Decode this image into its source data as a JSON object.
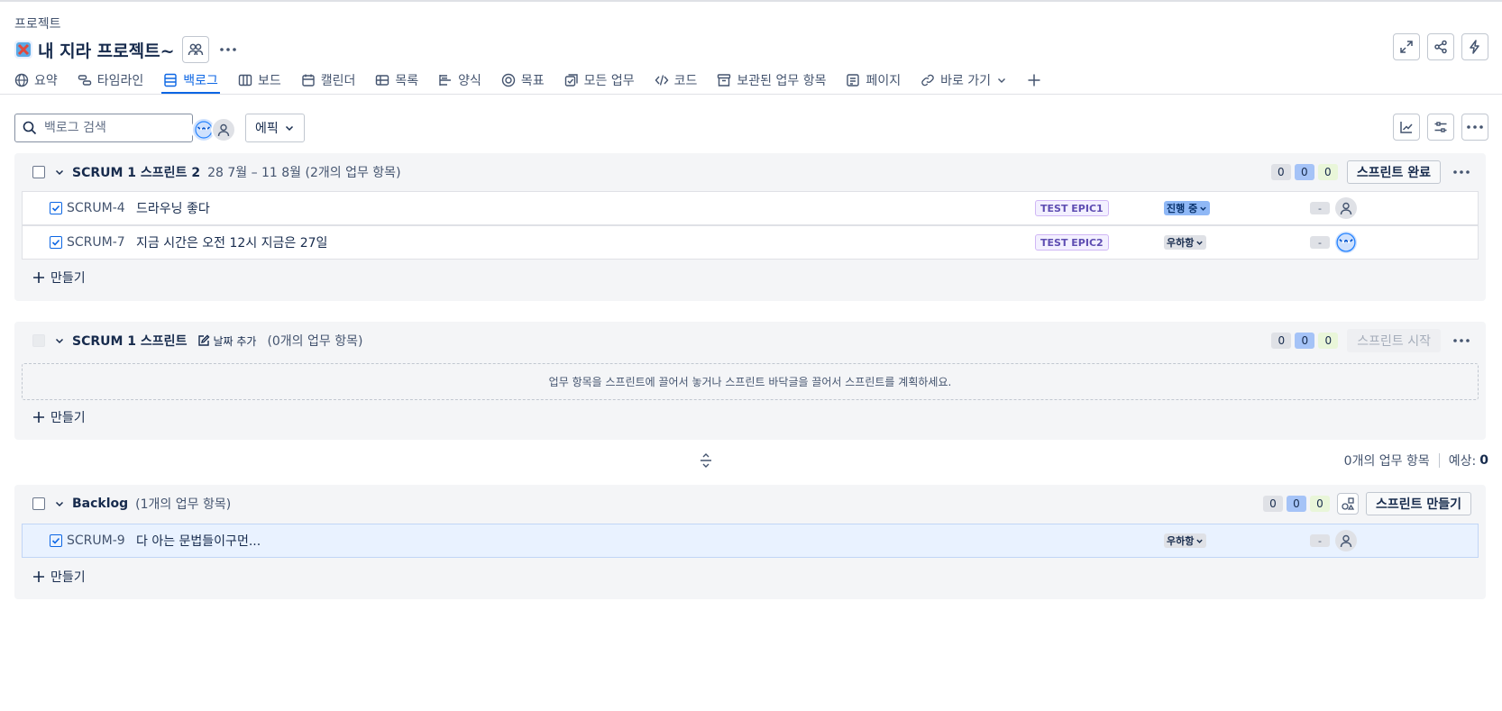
{
  "breadcrumb": "프로젝트",
  "project": {
    "title": "내 지라 프로젝트~"
  },
  "tabs": [
    {
      "label": "요약",
      "icon": "globe-icon"
    },
    {
      "label": "타임라인",
      "icon": "timeline-icon"
    },
    {
      "label": "백로그",
      "icon": "backlog-icon",
      "active": true
    },
    {
      "label": "보드",
      "icon": "board-icon"
    },
    {
      "label": "캘린더",
      "icon": "calendar-icon"
    },
    {
      "label": "목록",
      "icon": "list-icon"
    },
    {
      "label": "양식",
      "icon": "form-icon"
    },
    {
      "label": "목표",
      "icon": "goal-icon"
    },
    {
      "label": "모든 업무",
      "icon": "all-work-icon"
    },
    {
      "label": "코드",
      "icon": "code-icon"
    },
    {
      "label": "보관된 업무 항목",
      "icon": "archive-icon"
    },
    {
      "label": "페이지",
      "icon": "page-icon"
    },
    {
      "label": "바로 가기",
      "icon": "link-icon"
    }
  ],
  "search": {
    "placeholder": "백로그 검색"
  },
  "epic_filter": "에픽",
  "sprints": [
    {
      "name": "SCRUM 1 스프린트 2",
      "meta": "28 7월 – 11 8월 (2개의 업무 항목)",
      "counts": [
        "0",
        "0",
        "0"
      ],
      "action": "스프린트 완료",
      "issues": [
        {
          "key": "SCRUM-4",
          "summary": "드라우닝 좋다",
          "epic": "TEST EPIC1",
          "status": "진행 중",
          "estimate": "-"
        },
        {
          "key": "SCRUM-7",
          "summary": "지금 시간은 오전 12시 지금은 27일",
          "epic": "TEST EPIC2",
          "status": "우하항",
          "estimate": "-"
        }
      ],
      "create_label": "만들기"
    },
    {
      "name": "SCRUM 1 스프린트",
      "add_date": "날짜 추가",
      "meta": "(0개의 업무 항목)",
      "counts": [
        "0",
        "0",
        "0"
      ],
      "action": "스프린트 시작",
      "empty_message": "업무 항목을 스프린트에 끌어서 놓거나 스프린트 바닥글을 끌어서 스프린트를 계획하세요.",
      "create_label": "만들기"
    }
  ],
  "summary_line": {
    "count_text": "0개의 업무 항목",
    "estimate_label": "예상:",
    "estimate_value": "0"
  },
  "backlog": {
    "name": "Backlog",
    "meta": "(1개의 업무 항목)",
    "counts": [
      "0",
      "0",
      "0"
    ],
    "action": "스프린트 만들기",
    "issues": [
      {
        "key": "SCRUM-9",
        "summary": "다 아는 문법들이구먼...",
        "status": "우하항",
        "estimate": "-"
      }
    ],
    "create_label": "만들기"
  },
  "colors": {
    "accent": "#0c66e4",
    "panel_bg": "#f4f5f7",
    "epic_purple": "#5e4db2"
  }
}
